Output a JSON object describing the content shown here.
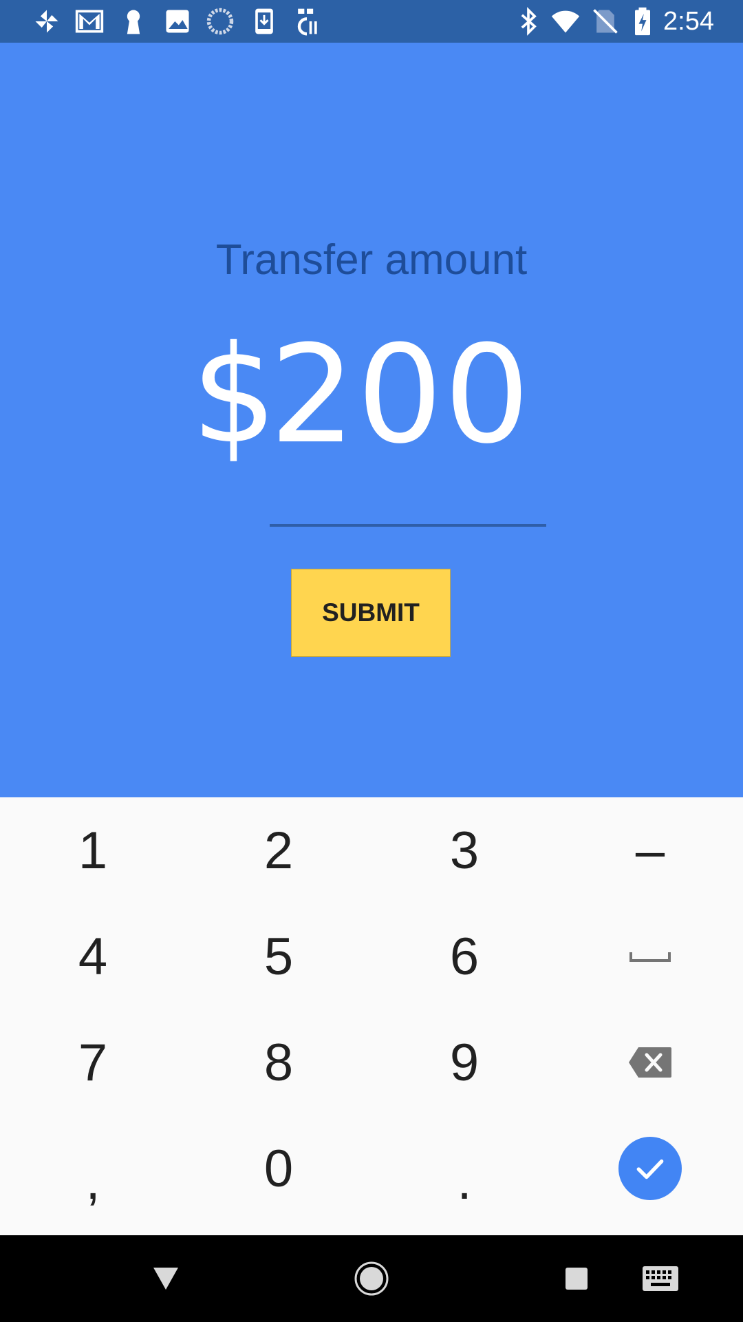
{
  "status_bar": {
    "time": "2:54",
    "left_icons": [
      "pinwheel-icon",
      "gmail-icon",
      "keyhole-icon",
      "image-icon",
      "loading-circle-icon",
      "download-phone-icon",
      "hk-news-icon"
    ],
    "right_icons": [
      "bluetooth-icon",
      "wifi-icon",
      "no-sim-icon",
      "battery-charging-icon"
    ],
    "background_color": "#2c61a6"
  },
  "main": {
    "title": "Transfer amount",
    "currency_symbol": "$",
    "amount": "200",
    "submit_label": "SUBMIT",
    "background_color": "#4a89f4",
    "submit_color": "#ffd54f"
  },
  "keypad": {
    "keys": [
      {
        "label": "1"
      },
      {
        "label": "2"
      },
      {
        "label": "3"
      },
      {
        "label": "–"
      },
      {
        "label": "4"
      },
      {
        "label": "5"
      },
      {
        "label": "6"
      },
      {
        "label": "space",
        "icon": "space-bar-icon"
      },
      {
        "label": "7"
      },
      {
        "label": "8"
      },
      {
        "label": "9"
      },
      {
        "label": "backspace",
        "icon": "backspace-icon"
      },
      {
        "label": ","
      },
      {
        "label": "0"
      },
      {
        "label": "."
      },
      {
        "label": "done",
        "icon": "checkmark-icon"
      }
    ],
    "accent_color": "#4285f4"
  },
  "nav_bar": {
    "buttons": [
      "back-icon",
      "home-icon",
      "recents-icon",
      "keyboard-icon"
    ]
  }
}
